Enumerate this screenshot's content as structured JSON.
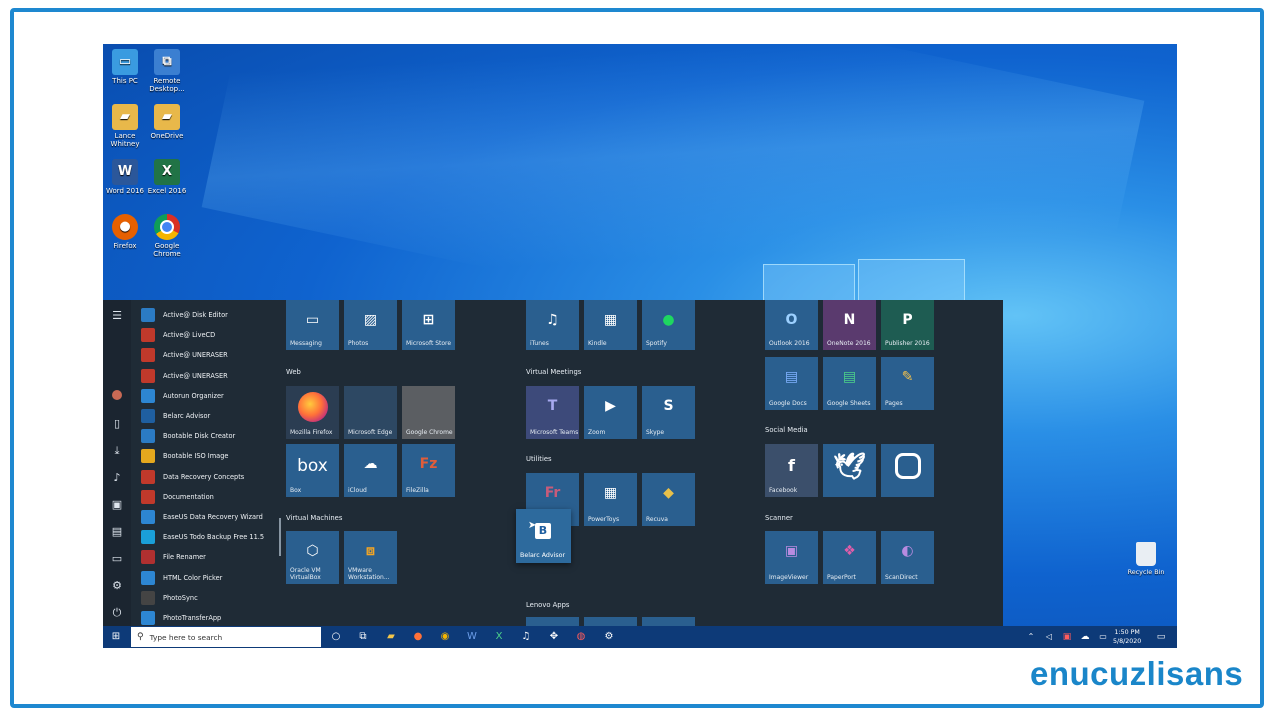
{
  "brand": "enucuzlisans",
  "desktop_icons": [
    {
      "label": "This PC",
      "icon": "pc-icon",
      "color": "#3a9be0"
    },
    {
      "label": "Remote Desktop...",
      "icon": "remote-desktop-icon",
      "color": "#3b7fd1"
    },
    {
      "label": "Lance Whitney",
      "icon": "user-folder-icon",
      "color": "#e8b84a"
    },
    {
      "label": "OneDrive",
      "icon": "onedrive-folder-icon",
      "color": "#e8b84a"
    },
    {
      "label": "Word 2016",
      "icon": "word-icon",
      "color": "#2b579a"
    },
    {
      "label": "Excel 2016",
      "icon": "excel-icon",
      "color": "#217346"
    },
    {
      "label": "Firefox",
      "icon": "firefox-icon",
      "color": "#e66000"
    },
    {
      "label": "Google Chrome",
      "icon": "chrome-icon",
      "color": "#d93025"
    }
  ],
  "recycle_bin": {
    "label": "Recycle Bin"
  },
  "app_list": [
    {
      "label": "Active@ Disk Editor",
      "icon": "disk-editor-icon",
      "color": "#2b7bc4"
    },
    {
      "label": "Active@ LiveCD",
      "icon": "livecd-icon",
      "color": "#c0392b"
    },
    {
      "label": "Active@ UNERASER",
      "icon": "uneraser-icon",
      "color": "#c0392b"
    },
    {
      "label": "Active@ UNERASER",
      "icon": "uneraser-icon",
      "color": "#c0392b"
    },
    {
      "label": "Autorun Organizer",
      "icon": "autorun-icon",
      "color": "#2d86d2"
    },
    {
      "label": "Belarc Advisor",
      "icon": "belarc-icon",
      "color": "#1f5fa0"
    },
    {
      "label": "Bootable Disk Creator",
      "icon": "bootable-disk-icon",
      "color": "#2b7bc4"
    },
    {
      "label": "Bootable ISO Image",
      "icon": "iso-icon",
      "color": "#e4a81e"
    },
    {
      "label": "Data Recovery Concepts",
      "icon": "data-recovery-icon",
      "color": "#c0392b"
    },
    {
      "label": "Documentation",
      "icon": "documentation-icon",
      "color": "#c0392b"
    },
    {
      "label": "EaseUS Data Recovery Wizard",
      "icon": "easeus-recovery-icon",
      "color": "#2d86d2"
    },
    {
      "label": "EaseUS Todo Backup Free 11.5",
      "icon": "easeus-backup-icon",
      "color": "#1a9fd8"
    },
    {
      "label": "File Renamer",
      "icon": "file-renamer-icon",
      "color": "#b03030"
    },
    {
      "label": "HTML Color Picker",
      "icon": "color-picker-icon",
      "color": "#2d86d2"
    },
    {
      "label": "PhotoSync",
      "icon": "photosync-icon",
      "color": "#444444"
    },
    {
      "label": "PhotoTransferApp",
      "icon": "phototransfer-icon",
      "color": "#2d86d2"
    }
  ],
  "groups": {
    "web": "Web",
    "virtual_machines": "Virtual Machines",
    "virtual_meetings": "Virtual Meetings",
    "utilities": "Utilities",
    "lenovo_apps": "Lenovo Apps",
    "social_media": "Social Media",
    "scanner": "Scanner"
  },
  "tiles": {
    "messaging": {
      "label": "Messaging",
      "icon": "messaging-icon"
    },
    "photos": {
      "label": "Photos",
      "icon": "photos-icon"
    },
    "store": {
      "label": "Microsoft Store",
      "icon": "store-icon"
    },
    "firefox": {
      "label": "Mozilla Firefox",
      "icon": "firefox-icon"
    },
    "edge": {
      "label": "Microsoft Edge",
      "icon": "edge-icon"
    },
    "chrome": {
      "label": "Google Chrome",
      "icon": "chrome-icon"
    },
    "box": {
      "label": "Box",
      "glyph": "box"
    },
    "icloud": {
      "label": "iCloud",
      "icon": "icloud-icon"
    },
    "filezilla": {
      "label": "FileZilla",
      "glyph": "Fz"
    },
    "virtualbox": {
      "label": "Oracle VM VirtualBox",
      "icon": "virtualbox-icon"
    },
    "vmware": {
      "label": "VMware Workstation...",
      "icon": "vmware-icon"
    },
    "itunes": {
      "label": "iTunes",
      "icon": "itunes-icon"
    },
    "kindle": {
      "label": "Kindle",
      "icon": "kindle-icon"
    },
    "spotify": {
      "label": "Spotify",
      "icon": "spotify-icon"
    },
    "teams": {
      "label": "Microsoft Teams",
      "glyph": "T"
    },
    "zoom": {
      "label": "Zoom",
      "icon": "zoom-icon"
    },
    "skype": {
      "label": "Skype",
      "glyph": "S"
    },
    "fr": {
      "label": "",
      "glyph": "Fr"
    },
    "powertoys": {
      "label": "PowerToys",
      "icon": "powertoys-icon"
    },
    "recuva": {
      "label": "Recuva",
      "icon": "recuva-icon"
    },
    "belarc_drag": {
      "label": "Belarc Advisor",
      "glyph": "B"
    },
    "outlook": {
      "label": "Outlook 2016",
      "glyph": "O"
    },
    "onenote": {
      "label": "OneNote 2016",
      "glyph": "N"
    },
    "publisher": {
      "label": "Publisher 2016",
      "glyph": "P"
    },
    "gdocs": {
      "label": "Google Docs",
      "icon": "google-docs-icon"
    },
    "gsheets": {
      "label": "Google Sheets",
      "icon": "google-sheets-icon"
    },
    "pages": {
      "label": "Pages",
      "icon": "pages-icon"
    },
    "facebook": {
      "label": "Facebook",
      "glyph": "f"
    },
    "twitter": {
      "label": "",
      "icon": "twitter-icon"
    },
    "instagram": {
      "label": "",
      "icon": "instagram-icon"
    },
    "imageviewer": {
      "label": "ImageViewer",
      "icon": "imageviewer-icon"
    },
    "paperport": {
      "label": "PaperPort",
      "icon": "paperport-icon"
    },
    "scandirect": {
      "label": "ScanDirect",
      "icon": "scandirect-icon"
    }
  },
  "taskbar": {
    "search_placeholder": "Type here to search",
    "time": "1:50 PM",
    "date": "5/8/2020"
  },
  "colors": {
    "accent": "#1e88d0",
    "taskbar": "#0d3a78",
    "start_bg": "#1f2b36",
    "tile": "#2a5f8f"
  }
}
